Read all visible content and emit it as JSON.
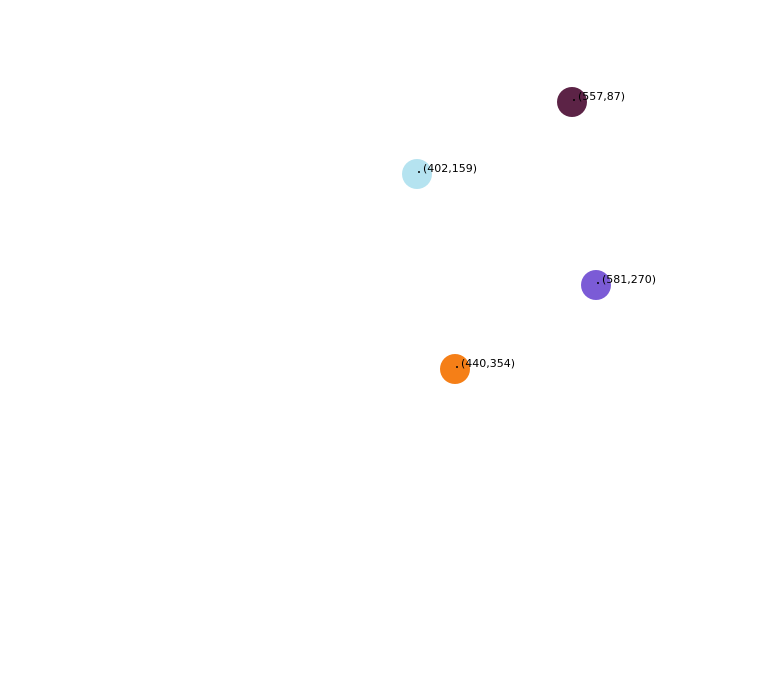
{
  "markers": [
    {
      "label": "(557,87)",
      "color": "#5c2346"
    },
    {
      "label": "(402,159)",
      "color": "#b5e3f0"
    },
    {
      "label": "(581,270)",
      "color": "#7b5bd6"
    },
    {
      "label": "(440,354)",
      "color": "#f57f17"
    }
  ]
}
